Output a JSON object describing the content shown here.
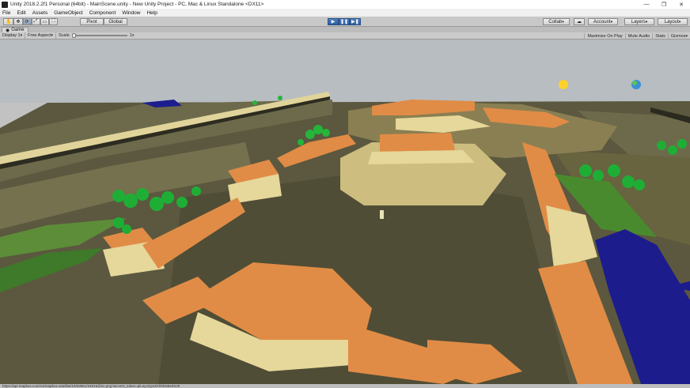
{
  "window": {
    "title": "Unity 2018.2.2f1 Personal (64bit) - MainScene.unity - New Unity Project - PC, Mac & Linux Standalone <DX11>",
    "controls": [
      "—",
      "❐",
      "✕"
    ]
  },
  "menu": [
    "File",
    "Edit",
    "Assets",
    "GameObject",
    "Component",
    "Window",
    "Help"
  ],
  "toolbar": {
    "tools": [
      "✋",
      "✥",
      "⟳",
      "⤢",
      "▭",
      "⛶"
    ],
    "pivot": "Pivot",
    "global": "Global",
    "play": "▶",
    "pause": "❚❚",
    "step": "▶❚",
    "collab": "Collab",
    "cloud": "☁",
    "account": "Account",
    "layers": "Layers",
    "layout": "Layout"
  },
  "game_view": {
    "tab_label": "Game",
    "display": "Display 1",
    "aspect": "Free Aspect",
    "scale_label": "Scale",
    "scale_value": "1x",
    "maximize": "Maximize On Play",
    "mute": "Mute Audio",
    "stats": "Stats",
    "gizmos": "Gizmos"
  },
  "status_bar": {
    "text": "https://api.mapbox.com/v4/mapbox.satellite/16/53961/24815@2x.png?access_token=pk.eyJ1IjoiZXhhbXBsZSJ9"
  },
  "colors": {
    "sky": "#b7bcc0",
    "ground": "#58553c",
    "roof": "#e08d48",
    "wall": "#e6d79a",
    "tree": "#1fae35",
    "water": "#1c1c8c"
  }
}
